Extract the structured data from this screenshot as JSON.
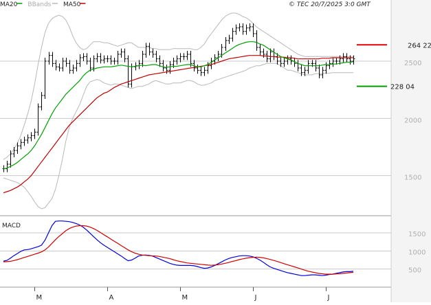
{
  "header": {
    "legend": [
      {
        "label": "MA20",
        "color": "#00a000"
      },
      {
        "label": "BBands",
        "color": "#b8b8b8"
      },
      {
        "label": "MA50",
        "color": "#c00000"
      }
    ],
    "copyright": "© TEC 20/7/2025 3:0 GMT"
  },
  "colors": {
    "background": "#ffffff",
    "grid": "#c8c8c8",
    "right_panel": "#f4f4f4",
    "price_bars": "#000000",
    "ma20": "#00a000",
    "ma50": "#c00000",
    "bbands": "#b8b8b8",
    "macd": "#0000e0",
    "signal": "#d00000",
    "resistance": "#e00000",
    "support": "#00a000"
  },
  "chart_data": [
    {
      "type": "ohlc",
      "panel": "price",
      "series_names": [
        "MA20",
        "BBands",
        "MA50"
      ],
      "ylim": [
        1150,
        2950
      ],
      "y_ticks": [
        {
          "value": 1500,
          "label": "1500"
        },
        {
          "value": 2000,
          "label": "2000"
        },
        {
          "value": 2500,
          "label": "2500"
        }
      ],
      "levels": [
        {
          "value": 2642.2,
          "label": "264 22",
          "color": "#e00000",
          "kind": "resistance"
        },
        {
          "value": 2280.4,
          "label": "228 04",
          "color": "#00a000",
          "kind": "support"
        }
      ],
      "x_labels": [
        {
          "index": 9,
          "label": "M"
        },
        {
          "index": 30,
          "label": "A"
        },
        {
          "index": 51,
          "label": "M"
        },
        {
          "index": 72,
          "label": "J"
        },
        {
          "index": 93,
          "label": "J"
        }
      ],
      "close": [
        1560,
        1600,
        1690,
        1720,
        1760,
        1790,
        1810,
        1830,
        1850,
        1880,
        2100,
        2200,
        2500,
        2550,
        2480,
        2450,
        2440,
        2500,
        2480,
        2420,
        2440,
        2480,
        2530,
        2540,
        2500,
        2440,
        2520,
        2540,
        2510,
        2520,
        2520,
        2500,
        2500,
        2560,
        2580,
        2520,
        2300,
        2450,
        2460,
        2480,
        2560,
        2630,
        2580,
        2560,
        2520,
        2480,
        2440,
        2420,
        2470,
        2500,
        2520,
        2540,
        2540,
        2560,
        2480,
        2440,
        2420,
        2400,
        2420,
        2460,
        2500,
        2530,
        2560,
        2620,
        2680,
        2700,
        2760,
        2790,
        2800,
        2760,
        2790,
        2800,
        2740,
        2620,
        2580,
        2560,
        2520,
        2580,
        2540,
        2500,
        2480,
        2500,
        2520,
        2500,
        2480,
        2440,
        2400,
        2420,
        2480,
        2480,
        2440,
        2380,
        2420,
        2460,
        2480,
        2500,
        2500,
        2520,
        2540,
        2520,
        2500,
        2520
      ],
      "bar_range": 60,
      "ma20": [
        1560,
        1565,
        1580,
        1595,
        1615,
        1640,
        1665,
        1690,
        1720,
        1760,
        1810,
        1860,
        1920,
        1980,
        2040,
        2090,
        2130,
        2170,
        2210,
        2240,
        2270,
        2300,
        2330,
        2370,
        2400,
        2420,
        2430,
        2440,
        2445,
        2450,
        2450,
        2450,
        2455,
        2460,
        2465,
        2460,
        2455,
        2450,
        2455,
        2460,
        2465,
        2460,
        2465,
        2470,
        2470,
        2460,
        2450,
        2445,
        2450,
        2455,
        2455,
        2460,
        2465,
        2470,
        2470,
        2460,
        2450,
        2450,
        2460,
        2470,
        2490,
        2510,
        2530,
        2550,
        2570,
        2590,
        2610,
        2630,
        2645,
        2655,
        2665,
        2670,
        2670,
        2665,
        2650,
        2640,
        2620,
        2600,
        2580,
        2560,
        2540,
        2530,
        2520,
        2510,
        2495,
        2480,
        2470,
        2460,
        2460,
        2460,
        2460,
        2460,
        2465,
        2470,
        2470,
        2475,
        2475,
        2480,
        2485,
        2490,
        2490,
        2495
      ],
      "bb_upper": [
        1640,
        1660,
        1690,
        1730,
        1780,
        1850,
        1940,
        2040,
        2150,
        2300,
        2470,
        2620,
        2750,
        2830,
        2870,
        2890,
        2900,
        2890,
        2860,
        2800,
        2720,
        2660,
        2620,
        2600,
        2610,
        2640,
        2670,
        2670,
        2670,
        2660,
        2660,
        2650,
        2640,
        2630,
        2640,
        2650,
        2660,
        2660,
        2640,
        2620,
        2620,
        2620,
        2620,
        2610,
        2610,
        2600,
        2600,
        2600,
        2600,
        2610,
        2610,
        2610,
        2610,
        2610,
        2610,
        2600,
        2600,
        2620,
        2650,
        2700,
        2740,
        2780,
        2820,
        2860,
        2890,
        2910,
        2920,
        2920,
        2910,
        2890,
        2880,
        2860,
        2830,
        2800,
        2780,
        2760,
        2740,
        2720,
        2700,
        2680,
        2660,
        2640,
        2620,
        2600,
        2580,
        2560,
        2550,
        2540,
        2540,
        2540,
        2540,
        2540,
        2540,
        2540,
        2540,
        2540,
        2540,
        2540,
        2540,
        2540,
        2540,
        2540
      ],
      "bb_lower": [
        1480,
        1470,
        1460,
        1450,
        1440,
        1420,
        1400,
        1360,
        1320,
        1270,
        1230,
        1210,
        1220,
        1260,
        1300,
        1380,
        1500,
        1640,
        1800,
        1920,
        2000,
        2060,
        2120,
        2200,
        2280,
        2320,
        2330,
        2340,
        2330,
        2310,
        2300,
        2290,
        2300,
        2300,
        2290,
        2280,
        2270,
        2260,
        2270,
        2280,
        2280,
        2290,
        2300,
        2320,
        2330,
        2320,
        2310,
        2300,
        2300,
        2310,
        2310,
        2310,
        2320,
        2330,
        2330,
        2320,
        2300,
        2290,
        2290,
        2300,
        2310,
        2330,
        2340,
        2350,
        2360,
        2370,
        2380,
        2390,
        2400,
        2410,
        2420,
        2440,
        2450,
        2460,
        2460,
        2470,
        2480,
        2480,
        2480,
        2480,
        2460,
        2440,
        2420,
        2420,
        2410,
        2400,
        2390,
        2380,
        2380,
        2380,
        2390,
        2390,
        2390,
        2395,
        2395,
        2400,
        2400,
        2400,
        2400,
        2400,
        2400,
        2400
      ],
      "ma50": [
        1350,
        1360,
        1370,
        1385,
        1400,
        1420,
        1445,
        1470,
        1500,
        1540,
        1580,
        1620,
        1660,
        1700,
        1740,
        1780,
        1820,
        1860,
        1900,
        1940,
        1970,
        2000,
        2030,
        2060,
        2090,
        2120,
        2150,
        2180,
        2200,
        2220,
        2230,
        2250,
        2270,
        2285,
        2300,
        2310,
        2320,
        2330,
        2340,
        2350,
        2360,
        2370,
        2380,
        2385,
        2390,
        2395,
        2400,
        2405,
        2410,
        2415,
        2420,
        2425,
        2430,
        2435,
        2440,
        2445,
        2450,
        2455,
        2460,
        2465,
        2470,
        2480,
        2490,
        2500,
        2510,
        2520,
        2525,
        2530,
        2535,
        2540,
        2545,
        2550,
        2550,
        2550,
        2550,
        2545,
        2545,
        2540,
        2540,
        2535,
        2535,
        2535,
        2530,
        2530,
        2525,
        2520,
        2520,
        2520,
        2520,
        2520,
        2520,
        2520,
        2525,
        2525,
        2525,
        2530,
        2530,
        2530,
        2530,
        2530,
        2530,
        2530
      ]
    },
    {
      "type": "line",
      "panel": "macd",
      "title": "MACD",
      "ylim": [
        0,
        1900
      ],
      "y_ticks": [
        {
          "value": 500,
          "label": "500"
        },
        {
          "value": 1000,
          "label": "1000"
        },
        {
          "value": 1500,
          "label": "1500"
        }
      ],
      "x_labels": [
        {
          "index": 9,
          "label": "M"
        },
        {
          "index": 30,
          "label": "A"
        },
        {
          "index": 51,
          "label": "M"
        },
        {
          "index": 72,
          "label": "J"
        },
        {
          "index": 93,
          "label": "J"
        }
      ],
      "series": [
        {
          "name": "macd",
          "color": "#0000e0",
          "values": [
            720,
            740,
            800,
            870,
            930,
            990,
            1030,
            1040,
            1060,
            1090,
            1120,
            1160,
            1300,
            1500,
            1700,
            1820,
            1830,
            1830,
            1820,
            1810,
            1790,
            1760,
            1720,
            1660,
            1580,
            1490,
            1400,
            1310,
            1230,
            1160,
            1100,
            1040,
            980,
            920,
            860,
            790,
            730,
            750,
            800,
            860,
            880,
            890,
            880,
            860,
            820,
            780,
            740,
            700,
            660,
            630,
            610,
            600,
            600,
            600,
            600,
            590,
            570,
            540,
            520,
            530,
            560,
            600,
            650,
            700,
            750,
            790,
            820,
            840,
            860,
            870,
            870,
            860,
            840,
            800,
            750,
            690,
            620,
            560,
            520,
            490,
            460,
            430,
            400,
            380,
            360,
            340,
            320,
            320,
            330,
            340,
            340,
            330,
            320,
            330,
            350,
            360,
            380,
            400,
            420,
            430,
            430,
            440
          ]
        },
        {
          "name": "signal",
          "color": "#d00000",
          "values": [
            700,
            705,
            715,
            735,
            760,
            790,
            820,
            850,
            880,
            910,
            940,
            975,
            1030,
            1110,
            1210,
            1310,
            1400,
            1480,
            1560,
            1620,
            1660,
            1690,
            1700,
            1700,
            1690,
            1660,
            1620,
            1570,
            1510,
            1450,
            1390,
            1330,
            1270,
            1210,
            1150,
            1090,
            1030,
            980,
            940,
            910,
            890,
            880,
            870,
            865,
            860,
            850,
            830,
            810,
            790,
            760,
            730,
            710,
            690,
            670,
            660,
            650,
            640,
            630,
            620,
            610,
            605,
            610,
            620,
            640,
            660,
            680,
            710,
            730,
            760,
            780,
            800,
            815,
            825,
            830,
            825,
            810,
            790,
            765,
            740,
            710,
            680,
            650,
            620,
            590,
            560,
            530,
            500,
            470,
            440,
            420,
            400,
            380,
            370,
            360,
            360,
            360,
            365,
            370,
            380,
            390,
            400,
            410
          ]
        }
      ]
    }
  ]
}
